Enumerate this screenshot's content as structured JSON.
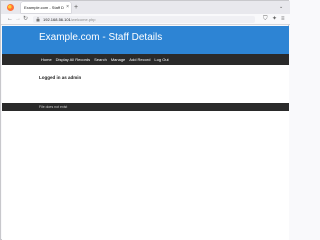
{
  "browser": {
    "tab_title": "Example.com - Staff Details",
    "tab_close": "×",
    "new_tab": "+",
    "tab_menu": "⌄",
    "url_host": "192.168.56.101",
    "url_path": "/welcome.php",
    "icons": {
      "back": "back-arrow-icon",
      "forward": "forward-arrow-icon",
      "reload": "reload-icon",
      "lock": "lock-icon",
      "pocket": "pocket-icon",
      "extensions": "extensions-icon",
      "menu": "hamburger-menu-icon"
    }
  },
  "page": {
    "site_title": "Example.com - Staff Details",
    "nav": [
      "Home",
      "Display All Records",
      "Search",
      "Manage",
      "Add Record",
      "Log Out"
    ],
    "login_status": "Logged in as admin",
    "footer_text": "File does not exist"
  },
  "colors": {
    "banner": "#2d84d4",
    "menubar": "#2a2a2a",
    "footer": "#2a2a2a"
  }
}
